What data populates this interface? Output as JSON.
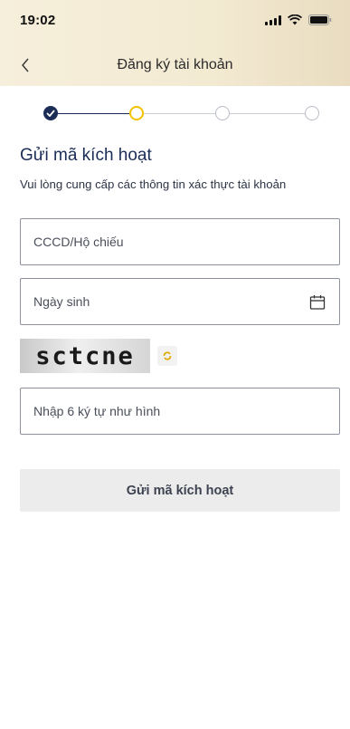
{
  "status_bar": {
    "time": "19:02"
  },
  "nav": {
    "title": "Đăng ký tài khoản"
  },
  "stepper": {
    "total_steps": 4,
    "completed_steps": 1,
    "current_step": 2
  },
  "form": {
    "title": "Gửi mã kích hoạt",
    "subtitle": "Vui lòng cung cấp các thông tin xác thực tài khoản",
    "id_field": {
      "placeholder": "CCCD/Hộ chiếu",
      "value": ""
    },
    "dob_field": {
      "placeholder": "Ngày sinh",
      "value": ""
    },
    "captcha": {
      "text": "sctcne"
    },
    "captcha_field": {
      "placeholder": "Nhập 6 ký tự như hình",
      "value": ""
    },
    "submit_label": "Gửi mã kích hoạt"
  },
  "colors": {
    "primary": "#1b2d57",
    "accent": "#f2c200",
    "header_bg": "#f4ecd8",
    "button_bg": "#ececec"
  },
  "icons": [
    "signal-icon",
    "wifi-icon",
    "battery-icon",
    "back-chevron-icon",
    "check-icon",
    "calendar-icon",
    "refresh-icon"
  ]
}
